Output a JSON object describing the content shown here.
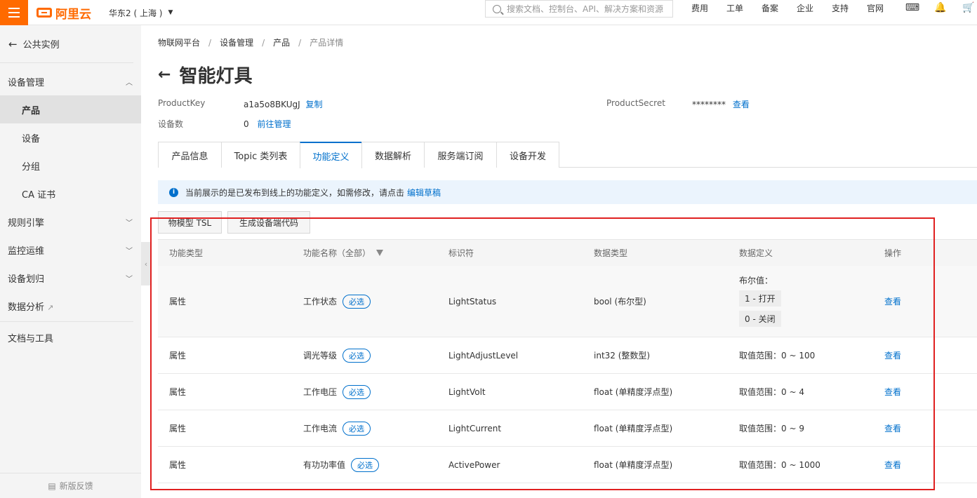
{
  "topbar": {
    "brand": "阿里云",
    "region": "华东2 ( 上海 )",
    "search_placeholder": "搜索文档、控制台、API、解决方案和资源",
    "nav": [
      "费用",
      "工单",
      "备案",
      "企业",
      "支持",
      "官网"
    ],
    "icons": [
      "terminal-icon",
      "bell-icon",
      "cart-icon"
    ]
  },
  "sidebar": {
    "back_label": "公共实例",
    "items": [
      {
        "label": "设备管理",
        "type": "group",
        "expanded": true
      },
      {
        "label": "产品",
        "type": "sub",
        "active": true
      },
      {
        "label": "设备",
        "type": "sub"
      },
      {
        "label": "分组",
        "type": "sub"
      },
      {
        "label": "CA 证书",
        "type": "sub"
      },
      {
        "label": "规则引擎",
        "type": "group"
      },
      {
        "label": "监控运维",
        "type": "group"
      },
      {
        "label": "设备划归",
        "type": "group"
      },
      {
        "label": "数据分析",
        "type": "external"
      },
      {
        "label": "文档与工具",
        "type": "plain"
      }
    ],
    "feedback": "新版反馈"
  },
  "breadcrumb": [
    "物联网平台",
    "设备管理",
    "产品",
    "产品详情"
  ],
  "page_title": "智能灯具",
  "meta": {
    "product_key_label": "ProductKey",
    "product_key": "a1a5o8BKUgJ",
    "copy": "复制",
    "device_count_label": "设备数",
    "device_count": "0",
    "manage": "前往管理",
    "secret_label": "ProductSecret",
    "secret": "********",
    "view": "查看"
  },
  "tabs": [
    {
      "label": "产品信息"
    },
    {
      "label": "Topic 类列表"
    },
    {
      "label": "功能定义",
      "active": true
    },
    {
      "label": "数据解析"
    },
    {
      "label": "服务端订阅"
    },
    {
      "label": "设备开发"
    }
  ],
  "notice": {
    "text": "当前展示的是已发布到线上的功能定义，如需修改，请点击",
    "link": "编辑草稿"
  },
  "buttons": {
    "tsl": "物模型 TSL",
    "gen": "生成设备端代码"
  },
  "table": {
    "headers": [
      "功能类型",
      "功能名称（全部）",
      "标识符",
      "数据类型",
      "数据定义",
      "操作"
    ],
    "rows": [
      {
        "type": "属性",
        "name": "工作状态",
        "tag": "必选",
        "id": "LightStatus",
        "dtype": "bool (布尔型)",
        "def_title": "布尔值：",
        "def_pills": [
          "1 - 打开",
          "0 - 关闭"
        ],
        "action": "查看"
      },
      {
        "type": "属性",
        "name": "调光等级",
        "tag": "必选",
        "id": "LightAdjustLevel",
        "dtype": "int32 (整数型)",
        "def": "取值范围：0 ~ 100",
        "action": "查看"
      },
      {
        "type": "属性",
        "name": "工作电压",
        "tag": "必选",
        "id": "LightVolt",
        "dtype": "float (单精度浮点型)",
        "def": "取值范围：0 ~ 4",
        "action": "查看"
      },
      {
        "type": "属性",
        "name": "工作电流",
        "tag": "必选",
        "id": "LightCurrent",
        "dtype": "float (单精度浮点型)",
        "def": "取值范围：0 ~ 9",
        "action": "查看"
      },
      {
        "type": "属性",
        "name": "有功功率值",
        "tag": "必选",
        "id": "ActivePower",
        "dtype": "float (单精度浮点型)",
        "def": "取值范围：0 ~ 1000",
        "action": "查看"
      }
    ]
  },
  "colors": {
    "brand": "#ff6a00",
    "link": "#0070cc",
    "highlight_box": "#e02020"
  }
}
